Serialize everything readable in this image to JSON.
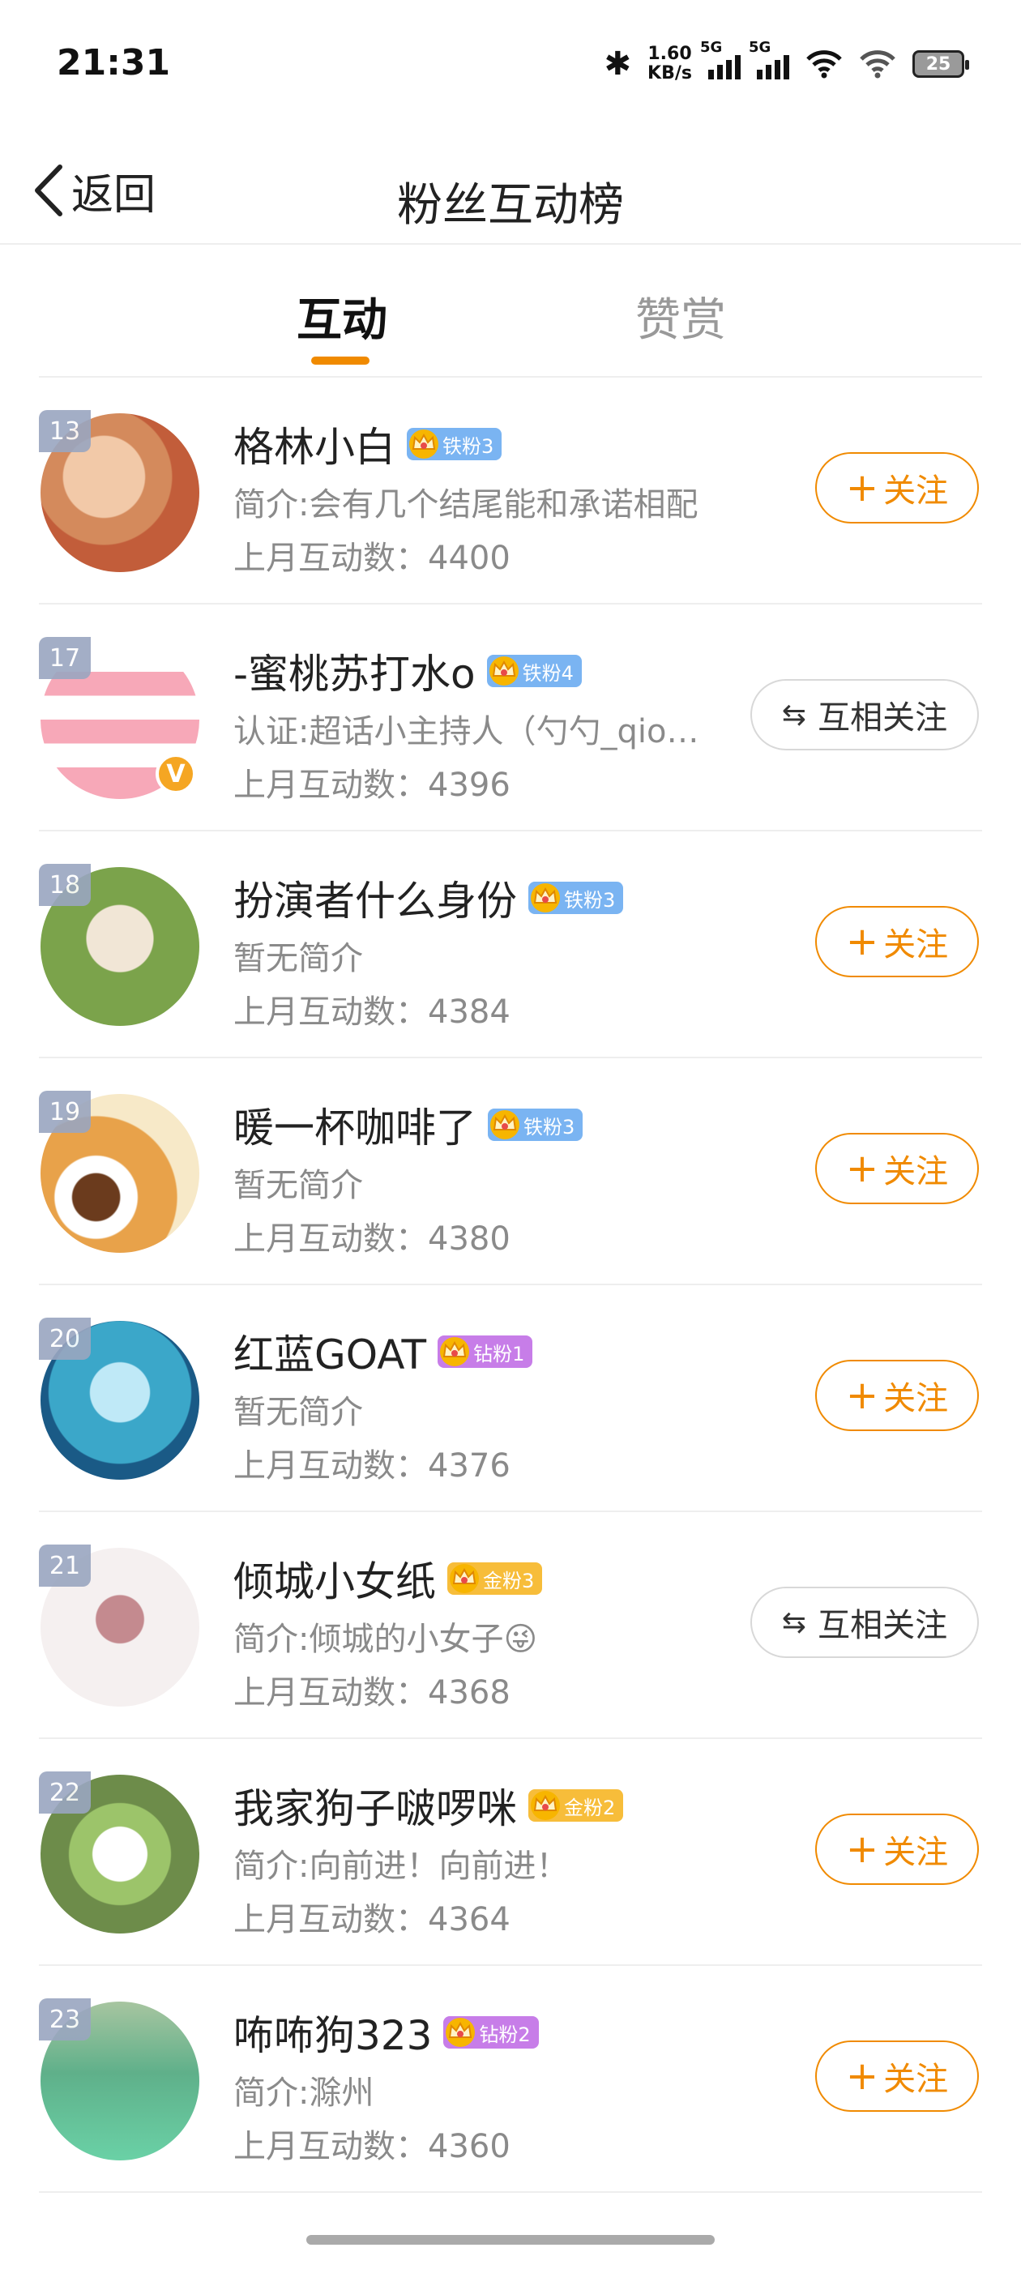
{
  "status": {
    "time": "21:31",
    "net_speed_value": "1.60",
    "net_speed_unit": "KB/s",
    "sim1": "5G",
    "sim2": "5G",
    "battery": "25"
  },
  "nav": {
    "back_label": "返回",
    "title": "粉丝互动榜"
  },
  "tabs": [
    {
      "label": "互动",
      "active": true
    },
    {
      "label": "赞赏",
      "active": false
    }
  ],
  "colors": {
    "accent": "#f08a00",
    "iron_badge": "#7ab4f2",
    "diamond_badge": "#c77de8",
    "gold_badge": "#f7bd3a",
    "rank_badge": "#9aa6c0"
  },
  "fans": [
    {
      "rank": "13",
      "name": "格林小白",
      "badge": "铁粉3",
      "badge_tier": "iron",
      "bio": "简介:会有几个结尾能和承诺相配",
      "interactions": "上月互动数：4400",
      "action": "follow",
      "action_label": "关注",
      "avatar_icon": "avatar-photo",
      "verified": false
    },
    {
      "rank": "17",
      "name": "-蜜桃苏打水o",
      "badge": "铁粉4",
      "badge_tier": "iron",
      "bio": "认证:超话小主持人（勺勺_qio…",
      "interactions": "上月互动数：4396",
      "action": "mutual",
      "action_label": "互相关注",
      "avatar_icon": "avatar-cartoon",
      "verified": true
    },
    {
      "rank": "18",
      "name": "扮演者什么身份",
      "badge": "铁粉3",
      "badge_tier": "iron",
      "bio": "暂无简介",
      "interactions": "上月互动数：4384",
      "action": "follow",
      "action_label": "关注",
      "avatar_icon": "avatar-photo",
      "verified": false
    },
    {
      "rank": "19",
      "name": "暖一杯咖啡了",
      "badge": "铁粉3",
      "badge_tier": "iron",
      "bio": "暂无简介",
      "interactions": "上月互动数：4380",
      "action": "follow",
      "action_label": "关注",
      "avatar_icon": "avatar-coffee",
      "verified": false
    },
    {
      "rank": "20",
      "name": "红蓝GOAT",
      "badge": "钻粉1",
      "badge_tier": "diamond",
      "bio": "暂无简介",
      "interactions": "上月互动数：4376",
      "action": "follow",
      "action_label": "关注",
      "avatar_icon": "avatar-anime",
      "verified": false
    },
    {
      "rank": "21",
      "name": "倾城小女纸",
      "badge": "金粉3",
      "badge_tier": "gold",
      "bio": "简介:倾城的小女子😜",
      "interactions": "上月互动数：4368",
      "action": "mutual",
      "action_label": "互相关注",
      "avatar_icon": "avatar-fairy",
      "verified": false
    },
    {
      "rank": "22",
      "name": "我家狗子啵啰咪",
      "badge": "金粉2",
      "badge_tier": "gold",
      "bio": "简介:向前进！向前进！",
      "interactions": "上月互动数：4364",
      "action": "follow",
      "action_label": "关注",
      "avatar_icon": "avatar-dog",
      "verified": false
    },
    {
      "rank": "23",
      "name": "咘咘狗323",
      "badge": "钻粉2",
      "badge_tier": "diamond",
      "bio": "简介:滁州",
      "interactions": "上月互动数：4360",
      "action": "follow",
      "action_label": "关注",
      "avatar_icon": "avatar-green",
      "verified": false
    }
  ]
}
